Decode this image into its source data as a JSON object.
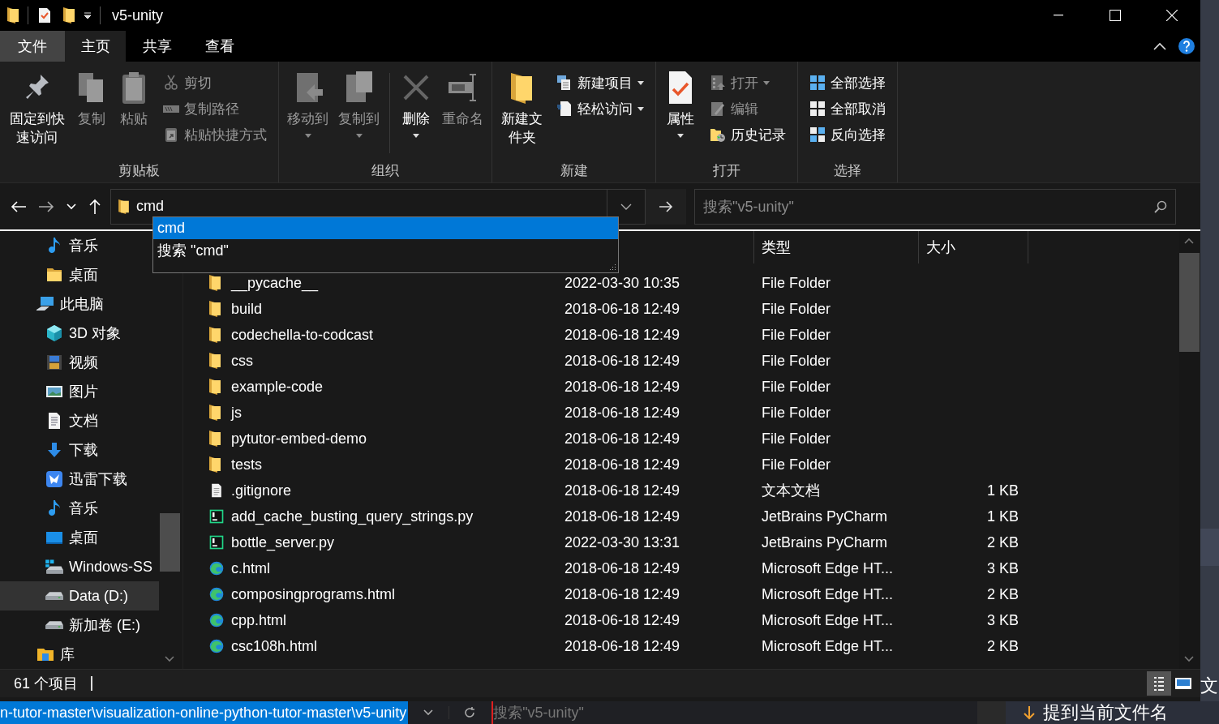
{
  "window": {
    "title": "v5-unity"
  },
  "ribbon_tabs": [
    {
      "label": "文件",
      "kind": "file",
      "selected": false
    },
    {
      "label": "主页",
      "kind": "tab",
      "selected": true
    },
    {
      "label": "共享",
      "kind": "tab",
      "selected": false
    },
    {
      "label": "查看",
      "kind": "tab",
      "selected": false
    }
  ],
  "ribbon": {
    "groups": [
      {
        "label": "剪贴板",
        "commands": [
          {
            "label": "固定到快速访问",
            "kind": "large",
            "disabled": false,
            "dropdown": false
          },
          {
            "label": "复制",
            "kind": "large",
            "disabled": true,
            "dropdown": false
          },
          {
            "label": "粘贴",
            "kind": "large",
            "disabled": true,
            "dropdown": false
          },
          {
            "label": "剪切",
            "kind": "small",
            "disabled": true,
            "dropdown": false
          },
          {
            "label": "复制路径",
            "kind": "small",
            "disabled": true,
            "dropdown": false
          },
          {
            "label": "粘贴快捷方式",
            "kind": "small",
            "disabled": true,
            "dropdown": false
          }
        ]
      },
      {
        "label": "组织",
        "commands": [
          {
            "label": "移动到",
            "kind": "large",
            "disabled": true,
            "dropdown": true
          },
          {
            "label": "复制到",
            "kind": "large",
            "disabled": true,
            "dropdown": true
          },
          {
            "label": "删除",
            "kind": "large",
            "disabled": false,
            "dropdown": true,
            "separator_before": true
          },
          {
            "label": "重命名",
            "kind": "large",
            "disabled": true,
            "dropdown": false
          }
        ]
      },
      {
        "label": "新建",
        "commands": [
          {
            "label": "新建文件夹",
            "kind": "large",
            "disabled": false,
            "dropdown": false
          },
          {
            "label": "新建项目",
            "kind": "small",
            "disabled": false,
            "dropdown": true
          },
          {
            "label": "轻松访问",
            "kind": "small",
            "disabled": false,
            "dropdown": true
          }
        ]
      },
      {
        "label": "打开",
        "commands": [
          {
            "label": "属性",
            "kind": "large",
            "disabled": false,
            "dropdown": true
          },
          {
            "label": "打开",
            "kind": "small",
            "disabled": true,
            "dropdown": true
          },
          {
            "label": "编辑",
            "kind": "small",
            "disabled": true,
            "dropdown": false
          },
          {
            "label": "历史记录",
            "kind": "small",
            "disabled": false,
            "dropdown": false
          }
        ]
      },
      {
        "label": "选择",
        "commands": [
          {
            "label": "全部选择",
            "kind": "small",
            "disabled": false,
            "dropdown": false
          },
          {
            "label": "全部取消",
            "kind": "small",
            "disabled": false,
            "dropdown": false
          },
          {
            "label": "反向选择",
            "kind": "small",
            "disabled": false,
            "dropdown": false
          }
        ]
      }
    ]
  },
  "address": {
    "value": "cmd",
    "suggestions": [
      {
        "label": "cmd",
        "selected": true
      },
      {
        "label": "搜索 \"cmd\"",
        "selected": false
      }
    ]
  },
  "search": {
    "placeholder": "搜索\"v5-unity\""
  },
  "sidebar": {
    "quick_access_items": [
      {
        "label": "音乐",
        "kind": "music",
        "selected": false
      },
      {
        "label": "桌面",
        "kind": "folder",
        "selected": false
      }
    ],
    "items": [
      {
        "label": "此电脑",
        "kind": "pc",
        "selected": false,
        "children": [
          {
            "label": "3D 对象",
            "kind": "cube",
            "selected": false
          },
          {
            "label": "视频",
            "kind": "video",
            "selected": false
          },
          {
            "label": "图片",
            "kind": "pictures",
            "selected": false
          },
          {
            "label": "文档",
            "kind": "documents",
            "selected": false
          },
          {
            "label": "下载",
            "kind": "download",
            "selected": false
          },
          {
            "label": "迅雷下载",
            "kind": "app",
            "selected": false
          },
          {
            "label": "音乐",
            "kind": "music",
            "selected": false
          },
          {
            "label": "桌面",
            "kind": "desktop",
            "selected": false
          },
          {
            "label": "Windows-SS",
            "kind": "windrive",
            "selected": false
          },
          {
            "label": "Data (D:)",
            "kind": "drive",
            "selected": true
          },
          {
            "label": "新加卷 (E:)",
            "kind": "drive",
            "selected": false
          }
        ]
      },
      {
        "label": "库",
        "kind": "library",
        "selected": false
      }
    ]
  },
  "table": {
    "columns": [
      "类型",
      "大小"
    ],
    "rows": [
      {
        "kind": "folder",
        "name": "__pycache__",
        "date": "2022-03-30 10:35",
        "type": "File Folder",
        "size": ""
      },
      {
        "kind": "folder",
        "name": "build",
        "date": "2018-06-18 12:49",
        "type": "File Folder",
        "size": ""
      },
      {
        "kind": "folder",
        "name": "codechella-to-codcast",
        "date": "2018-06-18 12:49",
        "type": "File Folder",
        "size": ""
      },
      {
        "kind": "folder",
        "name": "css",
        "date": "2018-06-18 12:49",
        "type": "File Folder",
        "size": ""
      },
      {
        "kind": "folder",
        "name": "example-code",
        "date": "2018-06-18 12:49",
        "type": "File Folder",
        "size": ""
      },
      {
        "kind": "folder",
        "name": "js",
        "date": "2018-06-18 12:49",
        "type": "File Folder",
        "size": ""
      },
      {
        "kind": "folder",
        "name": "pytutor-embed-demo",
        "date": "2018-06-18 12:49",
        "type": "File Folder",
        "size": ""
      },
      {
        "kind": "folder",
        "name": "tests",
        "date": "2018-06-18 12:49",
        "type": "File Folder",
        "size": ""
      },
      {
        "kind": "text",
        "name": ".gitignore",
        "date": "2018-06-18 12:49",
        "type": "文本文档",
        "size": "1 KB"
      },
      {
        "kind": "pycharm",
        "name": "add_cache_busting_query_strings.py",
        "date": "2018-06-18 12:49",
        "type": "JetBrains PyCharm",
        "size": "1 KB"
      },
      {
        "kind": "pycharm",
        "name": "bottle_server.py",
        "date": "2022-03-30 13:31",
        "type": "JetBrains PyCharm",
        "size": "2 KB"
      },
      {
        "kind": "edge",
        "name": "c.html",
        "date": "2018-06-18 12:49",
        "type": "Microsoft Edge HT...",
        "size": "3 KB"
      },
      {
        "kind": "edge",
        "name": "composingprograms.html",
        "date": "2018-06-18 12:49",
        "type": "Microsoft Edge HT...",
        "size": "2 KB"
      },
      {
        "kind": "edge",
        "name": "cpp.html",
        "date": "2018-06-18 12:49",
        "type": "Microsoft Edge HT...",
        "size": "3 KB"
      },
      {
        "kind": "edge",
        "name": "csc108h.html",
        "date": "2018-06-18 12:49",
        "type": "Microsoft Edge HT...",
        "size": "2 KB"
      }
    ]
  },
  "status_bar": {
    "item_count": "61 个项目"
  },
  "background_window": {
    "path": "n-tutor-master\\visualization-online-python-tutor-master\\v5-unity",
    "search_placeholder": "搜索\"v5-unity\"",
    "button": "提到当前文件名",
    "side_text": "文"
  }
}
